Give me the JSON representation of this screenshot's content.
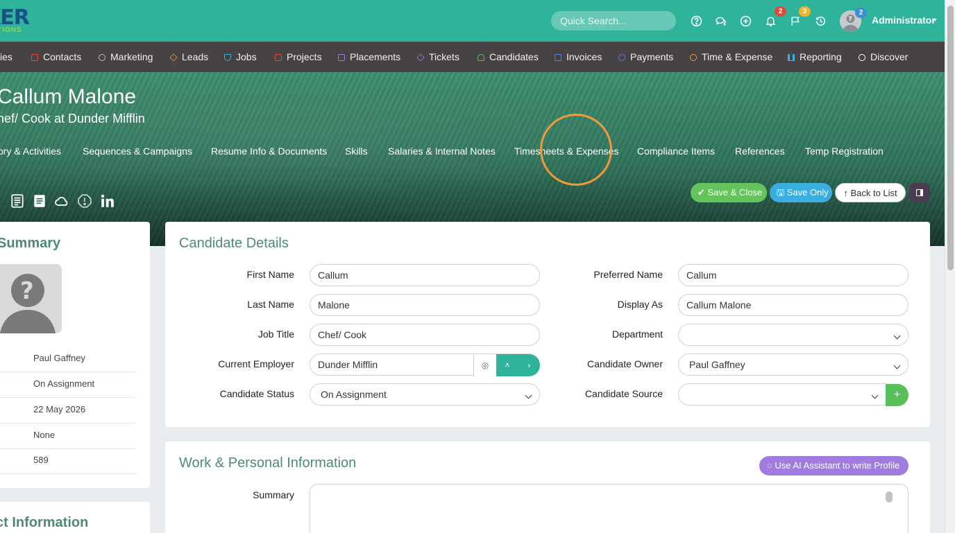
{
  "logo": {
    "big": "KER",
    "small": "UTIONS"
  },
  "topbar": {
    "search_placeholder": "Quick Search...",
    "notifications_count": "2",
    "flags_count": "3",
    "avatar_count": "2",
    "user_name": "Administrator"
  },
  "nav": {
    "items": [
      {
        "label": "ies",
        "icon": "companies-icon"
      },
      {
        "label": "Contacts",
        "icon": "contacts-icon"
      },
      {
        "label": "Marketing",
        "icon": "broadcast-icon"
      },
      {
        "label": "Leads",
        "icon": "diamond-icon"
      },
      {
        "label": "Jobs",
        "icon": "trophy-icon"
      },
      {
        "label": "Projects",
        "icon": "checkbox-icon"
      },
      {
        "label": "Placements",
        "icon": "bag-icon"
      },
      {
        "label": "Tickets",
        "icon": "tag-icon"
      },
      {
        "label": "Candidates",
        "icon": "user-icon"
      },
      {
        "label": "Invoices",
        "icon": "document-icon"
      },
      {
        "label": "Payments",
        "icon": "coin-icon"
      },
      {
        "label": "Time & Expense",
        "icon": "clock-icon"
      },
      {
        "label": "Reporting",
        "icon": "bar-chart-icon"
      },
      {
        "label": "Discover",
        "icon": "search-icon"
      }
    ]
  },
  "hero": {
    "name": "Callum Malone",
    "subtitle": "hef/ Cook at Dunder Mifflin",
    "tabs": [
      "ory & Activities",
      "Sequences & Campaigns",
      "Resume Info & Documents",
      "Skills",
      "Salaries & Internal Notes",
      "Timesheets & Expenses",
      "Compliance Items",
      "References",
      "Temp Registration"
    ],
    "buttons": {
      "save_close": "Save & Close",
      "save_only": "Save Only",
      "back": "Back to List"
    }
  },
  "summary": {
    "title": "Summary",
    "rows": [
      "Paul Gaffney",
      "On Assignment",
      "22 May 2026",
      "None",
      "589"
    ],
    "contact_title": "ct Information"
  },
  "details": {
    "title": "Candidate Details",
    "first_name_label": "First Name",
    "first_name": "Callum",
    "last_name_label": "Last Name",
    "last_name": "Malone",
    "job_title_label": "Job Title",
    "job_title": "Chef/ Cook",
    "employer_label": "Current Employer",
    "employer": "Dunder Mifflin",
    "status_label": "Candidate Status",
    "status": "On Assignment",
    "preferred_label": "Preferred Name",
    "preferred": "Callum",
    "display_label": "Display As",
    "display": "Callum Malone",
    "department_label": "Department",
    "department": "",
    "owner_label": "Candidate Owner",
    "owner": "Paul Gaffney",
    "source_label": "Candidate Source",
    "source": ""
  },
  "work": {
    "title": "Work & Personal Information",
    "ai_button": "Use AI Assistant to write Profile",
    "summary_label": "Summary"
  },
  "colors": {
    "topbar": "#2fb39a",
    "nav": "#474344",
    "accent_green": "#4d8b6e",
    "save_close": "#64c35a",
    "save_only": "#3aaee0",
    "ai": "#a07be0",
    "highlight": "#f09a3e"
  }
}
